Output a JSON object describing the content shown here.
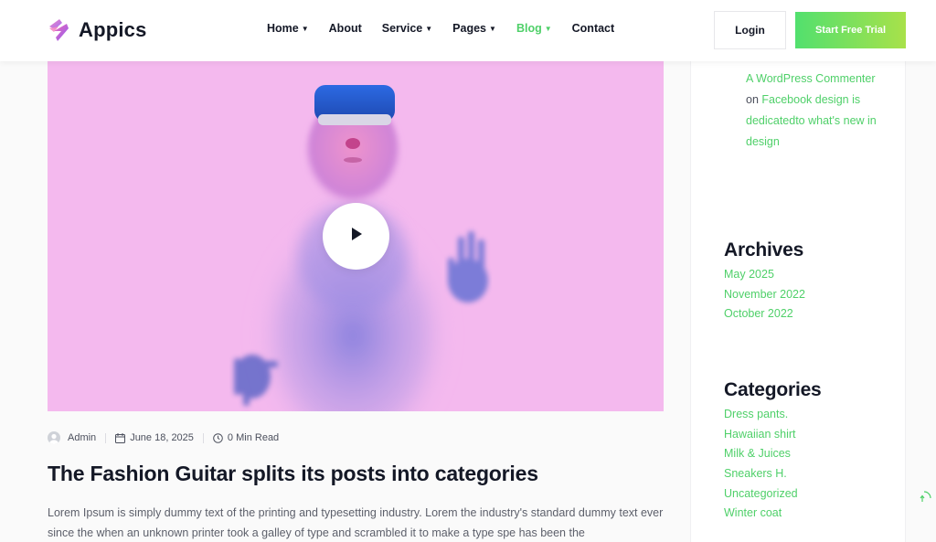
{
  "brand": {
    "name": "Appics"
  },
  "nav": {
    "items": [
      {
        "label": "Home",
        "has_dropdown": true,
        "active": false
      },
      {
        "label": "About",
        "has_dropdown": false,
        "active": false
      },
      {
        "label": "Service",
        "has_dropdown": true,
        "active": false
      },
      {
        "label": "Pages",
        "has_dropdown": true,
        "active": false
      },
      {
        "label": "Blog",
        "has_dropdown": true,
        "active": true
      },
      {
        "label": "Contact",
        "has_dropdown": false,
        "active": false
      }
    ],
    "login_label": "Login",
    "trial_label": "Start Free Trial"
  },
  "post": {
    "author": "Admin",
    "date": "June 18, 2025",
    "read_time": "0 Min Read",
    "title": "The Fashion Guitar splits its posts into categories",
    "excerpt": "Lorem Ipsum is simply dummy text of the printing and typesetting industry. Lorem the industry's standard dummy text ever since the when an unknown printer took a galley of type and scrambled it to make a type spe has been the"
  },
  "sidebar": {
    "recent_comment": {
      "author": "A WordPress Commenter",
      "connector": "on",
      "post": "Facebook design is dedicatedto what's new in design"
    },
    "archives": {
      "title": "Archives",
      "items": [
        "May 2025",
        "November 2022",
        "October 2022"
      ]
    },
    "categories": {
      "title": "Categories",
      "items": [
        "Dress pants.",
        "Hawaiian shirt",
        "Milk & Juices",
        "Sneakers H.",
        "Uncategorized",
        "Winter coat"
      ]
    }
  },
  "colors": {
    "accent": "#4fd069",
    "hero_bg": "#f4b9ee",
    "heading": "#141826"
  }
}
